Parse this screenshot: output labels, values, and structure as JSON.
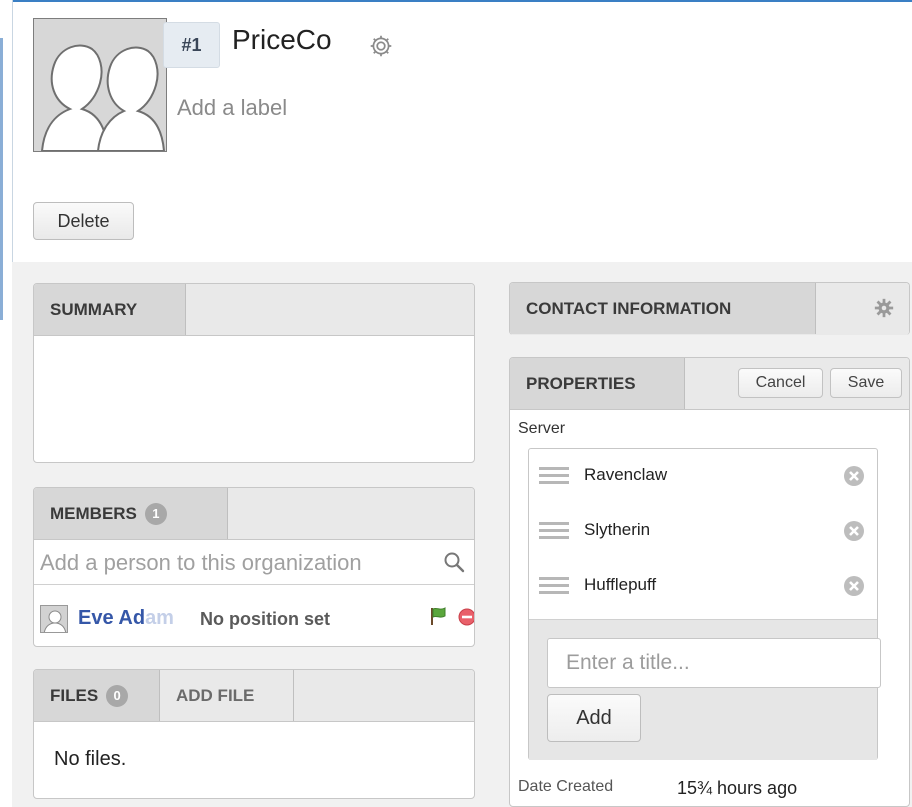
{
  "header": {
    "record_number": "#1",
    "org_name": "PriceCo",
    "add_label": "Add a label",
    "delete_label": "Delete"
  },
  "summary": {
    "title": "SUMMARY"
  },
  "members": {
    "title": "MEMBERS",
    "count": "1",
    "search_placeholder": "Add a person to this organization",
    "items": [
      {
        "name_visible": "Eve Ad",
        "name_faded": "am",
        "position": "No position set"
      }
    ]
  },
  "files": {
    "title": "FILES",
    "count": "0",
    "add_file": "ADD FILE",
    "empty_text": "No files."
  },
  "contact": {
    "title": "CONTACT INFORMATION"
  },
  "properties": {
    "title": "PROPERTIES",
    "cancel_label": "Cancel",
    "save_label": "Save",
    "field_label": "Server",
    "items": [
      "Ravenclaw",
      "Slytherin",
      "Hufflepuff"
    ],
    "title_placeholder": "Enter a title...",
    "add_label": "Add",
    "date_created_label": "Date Created",
    "date_created_value": "15¾ hours ago"
  },
  "colors": {
    "accent": "#3a7fc4",
    "member_link": "#3557a8",
    "remove_red": "#e9606a",
    "flag_green": "#5aa63c"
  }
}
